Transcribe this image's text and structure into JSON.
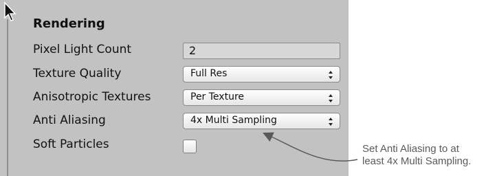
{
  "section": {
    "title": "Rendering"
  },
  "settings": [
    {
      "label": "Pixel Light Count",
      "control": "number",
      "value": "2"
    },
    {
      "label": "Texture Quality",
      "control": "select",
      "value": "Full Res"
    },
    {
      "label": "Anisotropic Textures",
      "control": "select",
      "value": "Per Texture"
    },
    {
      "label": "Anti Aliasing",
      "control": "select",
      "value": "4x Multi Sampling"
    },
    {
      "label": "Soft Particles",
      "control": "checkbox",
      "checked": false
    }
  ],
  "annotation": {
    "line1": "Set Anti Aliasing to at",
    "line2": "least 4x Multi Sampling."
  },
  "colors": {
    "panel": "#c2c2c2",
    "annotation": "#5a5a5a"
  }
}
